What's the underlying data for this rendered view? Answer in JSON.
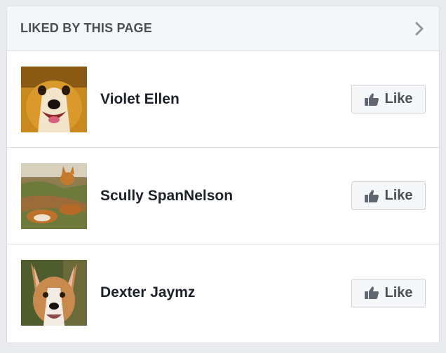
{
  "header": {
    "title": "LIKED BY THIS PAGE",
    "chevron_icon": "chevron-right-icon"
  },
  "pages": [
    {
      "name": "Violet Ellen",
      "like_label": "Like",
      "avatar": "corgi-face-avatar",
      "like_icon": "thumbs-up-icon"
    },
    {
      "name": "Scully SpanNelson",
      "like_label": "Like",
      "avatar": "dogs-lying-on-blanket-avatar",
      "like_icon": "thumbs-up-icon"
    },
    {
      "name": "Dexter Jaymz",
      "like_label": "Like",
      "avatar": "corgi-portrait-avatar",
      "like_icon": "thumbs-up-icon"
    }
  ],
  "colors": {
    "background": "#e9ebee",
    "header_background": "#f5f6f7",
    "header_text": "#4b4f56",
    "name_text": "#1d2129",
    "button_background": "#f6f7f9",
    "border": "#dddfe2"
  }
}
